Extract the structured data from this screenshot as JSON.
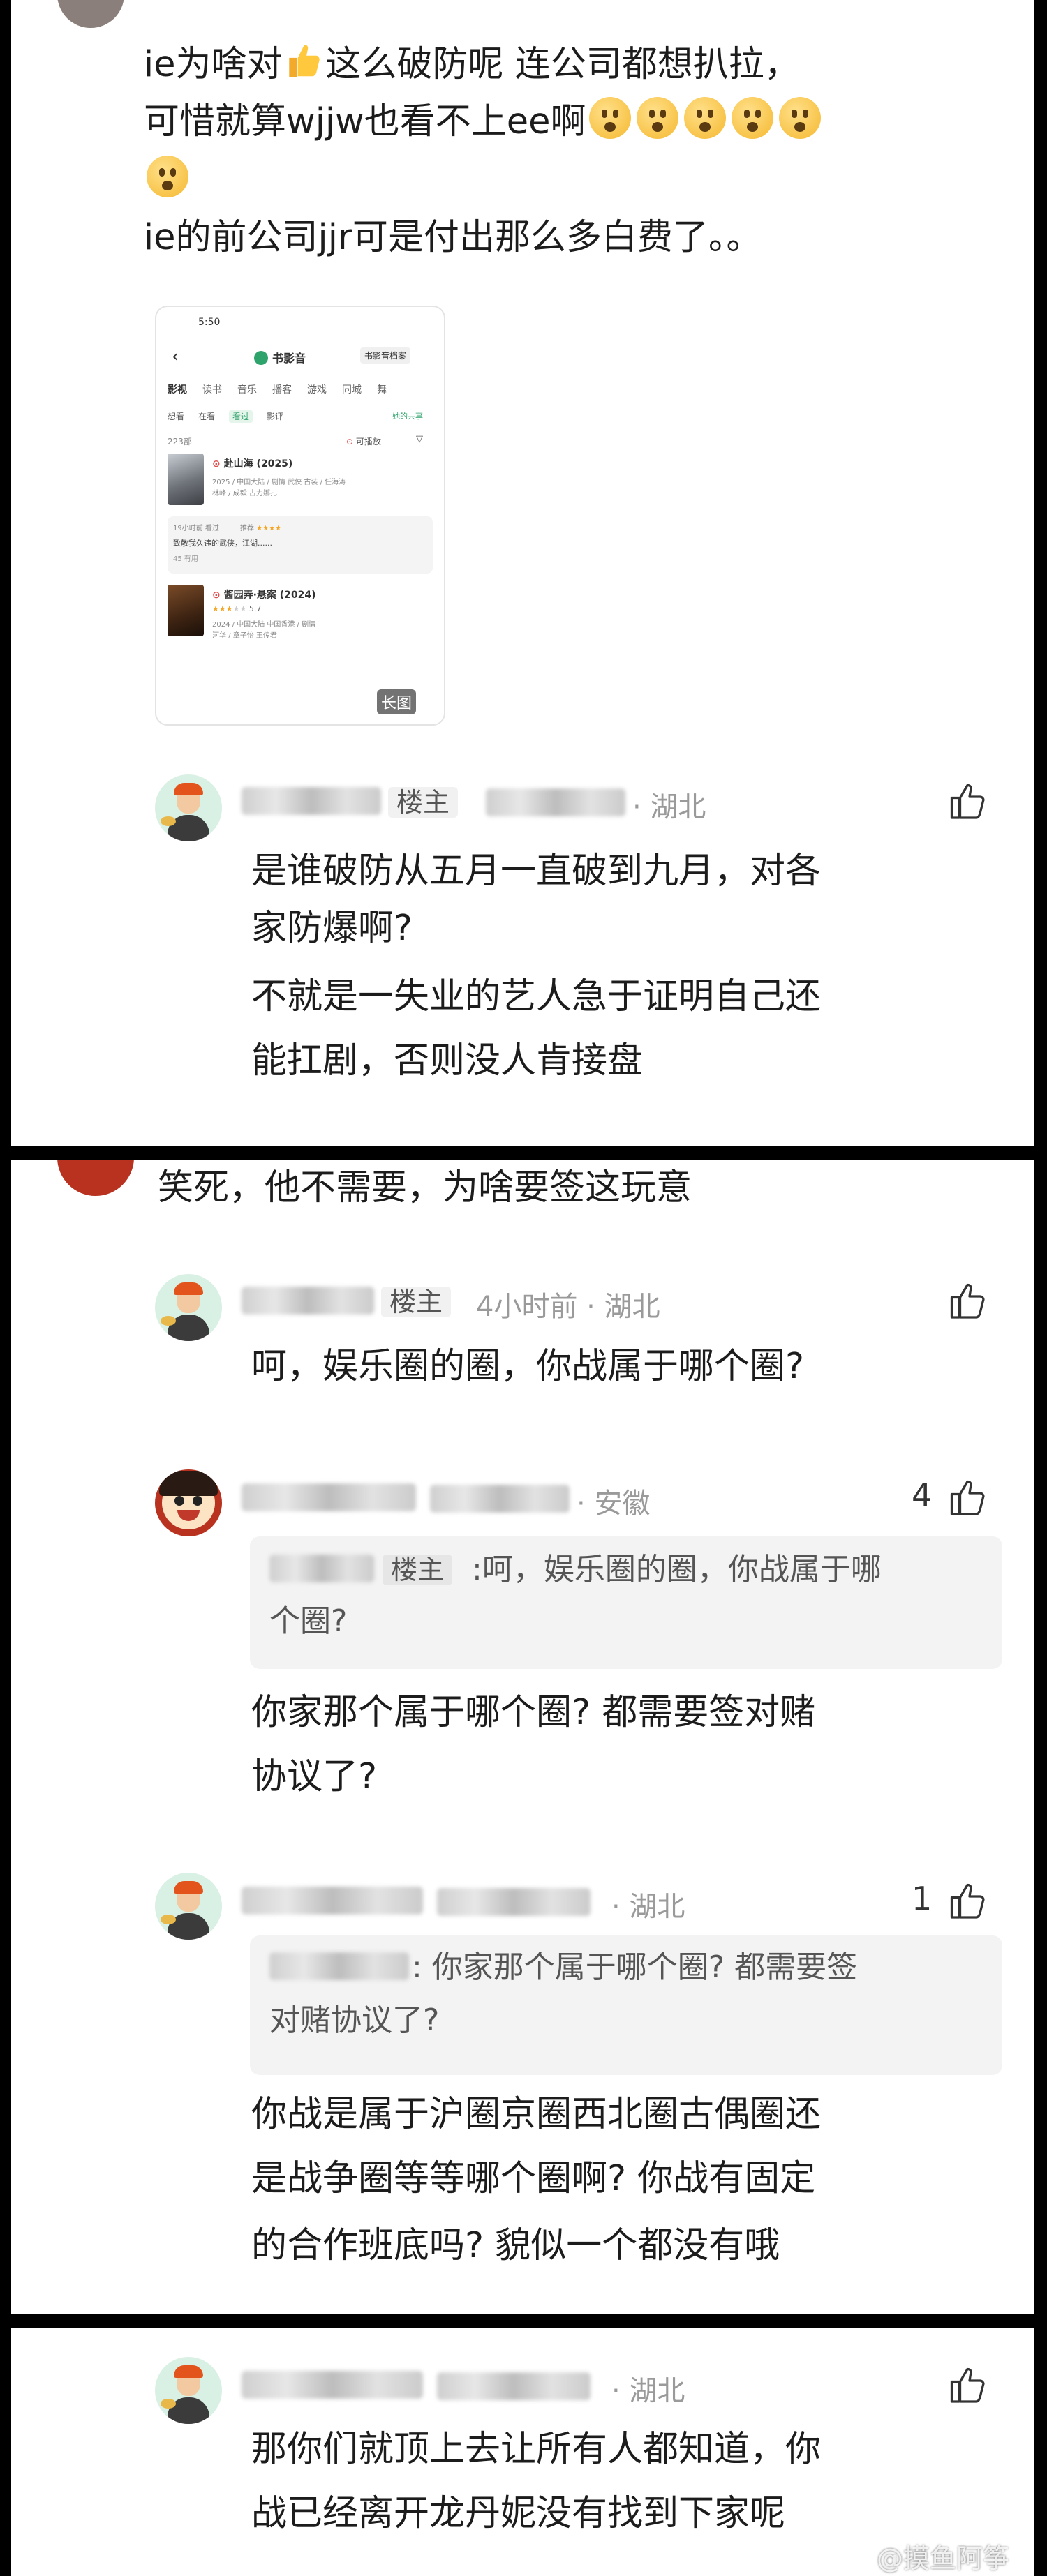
{
  "panel1": {
    "post_line1": "ie为啥对",
    "post_line1b": "这么破防呢 连公司都想扒拉，",
    "post_line2": "可惜就算wjjw也看不上ee啊",
    "post_line3": "ie的前公司jjr可是付出那么多白费了。。",
    "screenshot": {
      "time": "5:50",
      "title": "书影音",
      "archive_label": "书影音档案",
      "tabs": [
        "影视",
        "读书",
        "音乐",
        "播客",
        "游戏",
        "同城",
        "舞"
      ],
      "subtabs": [
        "想看",
        "在看",
        "看过",
        "影评"
      ],
      "share_label": "她的共享",
      "count": "223部",
      "playable": "可播放",
      "item1_title": "赴山海 (2025)",
      "item1_meta1": "2025 / 中国大陆 / 剧情 武侠 古装 / 任海涛",
      "item1_meta2": "林峰 / 成毅 古力娜扎",
      "review_time": "19小时前",
      "review_status": "看过",
      "review_rating_label": "推荐",
      "review_text": "致敬我久违的武侠，江湖......",
      "review_likes": "45 有用",
      "item2_title": "酱园弄·悬案 (2024)",
      "item2_score": "5.7",
      "item2_meta1": "2024 / 中国大陆 中国香港 / 剧情",
      "item2_meta2": "河华 / 章子怡 王传君",
      "long_image_label": "长图"
    },
    "reply1": {
      "role": "楼主",
      "location": "湖北",
      "line1": "是谁破防从五月一直破到九月，对各",
      "line2": "家防爆啊?",
      "line3": "不就是一失业的艺人急于证明自己还",
      "line4": "能扛剧，否则没人肯接盘"
    }
  },
  "panel2": {
    "comment_line": "笑死，他不需要，为啥要签这玩意",
    "reply1": {
      "role": "楼主",
      "time_location": "4小时前 · 湖北",
      "text": "呵，娱乐圈的圈，你战属于哪个圈?"
    },
    "reply2": {
      "location": "安徽",
      "likes": "4",
      "quote_role": "楼主",
      "quote_line1": ":呵，娱乐圈的圈，你战属于哪",
      "quote_line2": "个圈?",
      "line1": "你家那个属于哪个圈? 都需要签对赌",
      "line2": "协议了?"
    },
    "reply3": {
      "location": "湖北",
      "likes": "1",
      "quote_line1": ": 你家那个属于哪个圈? 都需要签",
      "quote_line2": "对赌协议了?",
      "line1": "你战是属于沪圈京圈西北圈古偶圈还",
      "line2": "是战争圈等等哪个圈啊? 你战有固定",
      "line3": "的合作班底吗? 貌似一个都没有哦"
    }
  },
  "panel3": {
    "reply1": {
      "location": "湖北",
      "line1": "那你们就顶上去让所有人都知道，你",
      "line2": "战已经离开龙丹妮没有找到下家呢"
    },
    "watermark": "@摸鱼阿筝"
  },
  "colors": {
    "background": "#000000",
    "panel": "#ffffff",
    "text": "#1c1c1c",
    "meta": "#9a9a9a",
    "green": "#2ea36b"
  }
}
